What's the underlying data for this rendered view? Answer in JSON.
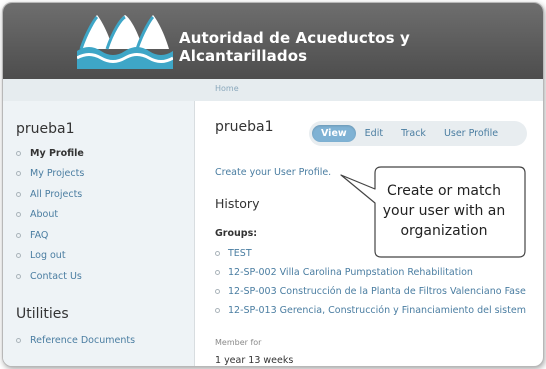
{
  "header": {
    "site_title": "Autoridad de Acueductos y Alcantarillados",
    "logo_icon": "water-waves-logo"
  },
  "breadcrumb": {
    "home": "Home"
  },
  "sidebar": {
    "user_name": "prueba1",
    "nav": [
      {
        "label": "My Profile",
        "active": true
      },
      {
        "label": "My Projects"
      },
      {
        "label": "All Projects"
      },
      {
        "label": "About"
      },
      {
        "label": "FAQ"
      },
      {
        "label": "Log out"
      },
      {
        "label": "Contact Us"
      }
    ],
    "utilities_heading": "Utilities",
    "utilities": [
      {
        "label": "Reference Documents"
      }
    ]
  },
  "main": {
    "title": "prueba1",
    "tabs": [
      {
        "label": "View",
        "active": true
      },
      {
        "label": "Edit"
      },
      {
        "label": "Track"
      },
      {
        "label": "User Profile"
      }
    ],
    "create_profile_link": "Create your User Profile.",
    "history_heading": "History",
    "groups_label": "Groups:",
    "groups": [
      "TEST",
      "12-SP-002 Villa Carolina Pumpstation Rehabilitation",
      "12-SP-003 Construcción de la Planta de Filtros Valenciano Fase",
      "12-SP-013 Gerencia, Construcción y Financiamiento del sistem"
    ],
    "member_for_label": "Member for",
    "member_for_value": "1 year 13 weeks"
  },
  "callout": {
    "lines": [
      "Create or match",
      "your user with an",
      "organization"
    ]
  },
  "colors": {
    "header_bg": "#5a5a5a",
    "link": "#4a7da1",
    "sidebar_bg": "#eef3f6",
    "active_tab": "#7fb2d4"
  }
}
